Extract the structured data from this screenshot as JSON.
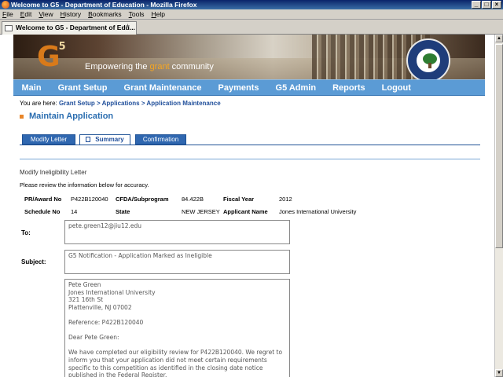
{
  "window": {
    "title": "Welcome to G5 - Department of Education - Mozilla Firefox"
  },
  "menu": [
    "File",
    "Edit",
    "View",
    "History",
    "Bookmarks",
    "Tools",
    "Help"
  ],
  "browser_tab": {
    "label": "Welcome to G5 - Department of Edu...",
    "new_tab": "+"
  },
  "banner": {
    "logo": "G",
    "logo_sup": "5",
    "tagline_pre": "Empowering the ",
    "tagline_grant": "grant",
    "tagline_post": " community"
  },
  "nav": [
    "Main",
    "Grant Setup",
    "Grant Maintenance",
    "Payments",
    "G5 Admin",
    "Reports",
    "Logout"
  ],
  "breadcrumb": {
    "prefix": "You are here: ",
    "items": [
      "Grant Setup",
      "Applications",
      "Application Maintenance"
    ],
    "sep": " > "
  },
  "page": {
    "title": "Maintain Application"
  },
  "tabs": {
    "modify": "Modify Letter",
    "summary": "Summary",
    "confirm": "Confirmation"
  },
  "section": {
    "label": "Modify Ineligibility Letter",
    "instruction": "Please review the information below for accuracy."
  },
  "info": {
    "award_label": "PR/Award No",
    "award_value": "P422B120040",
    "cfda_label": "CFDA/Subprogram",
    "cfda_value": "84.422B",
    "fy_label": "Fiscal Year",
    "fy_value": "2012",
    "schedule_label": "Schedule No",
    "schedule_value": "14",
    "state_label": "State",
    "state_value": "NEW JERSEY",
    "applicant_label": "Applicant Name",
    "applicant_value": "Jones International University"
  },
  "form": {
    "to_label": "To:",
    "to_value": "pete.green12@jiu12.edu",
    "subject_label": "Subject:",
    "subject_value": "G5 Notification - Application Marked as Ineligible",
    "body": "Pete Green\nJones International University\n321 16th St\nPlattenville, NJ 07002\n\nReference: P422B120040\n\nDear Pete Green:\n\nWe have completed our eligibility review for P422B120040. We regret to inform you that your application did not meet certain requirements specific to this competition as identified in the closing date notice published in the Federal Register."
  }
}
